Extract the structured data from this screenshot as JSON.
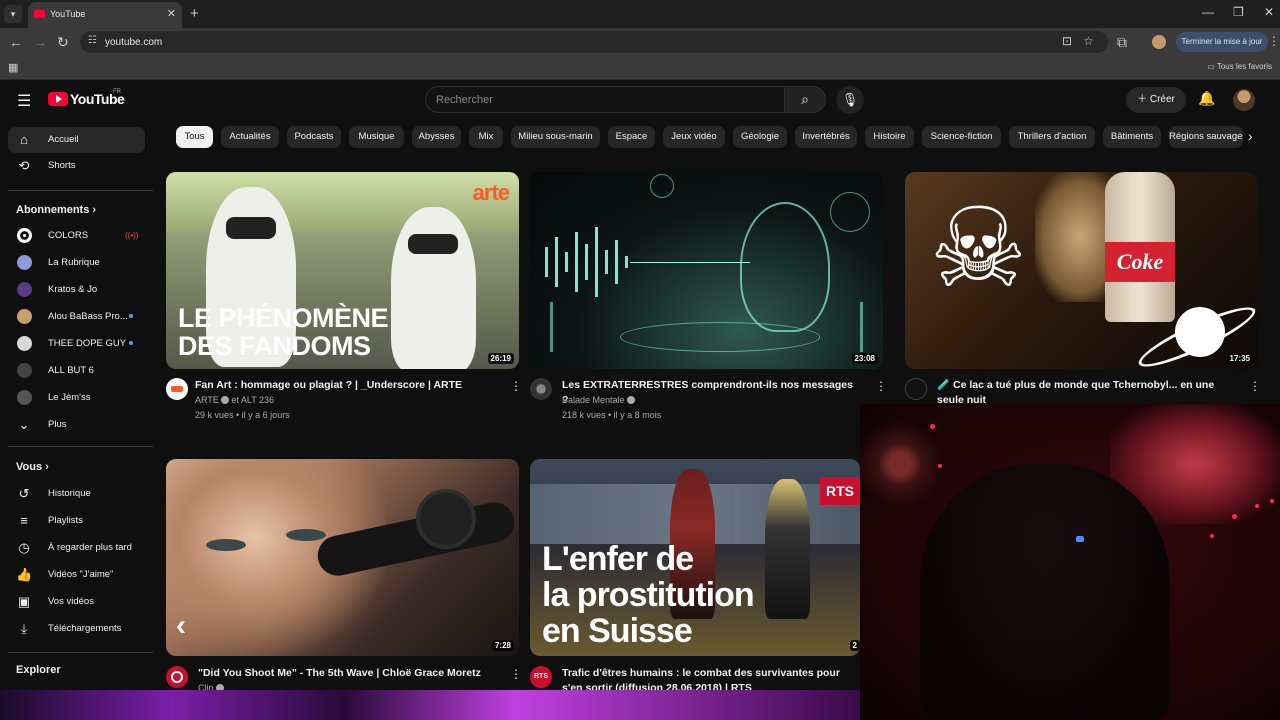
{
  "browser": {
    "tab_title": "YouTube",
    "url": "youtube.com",
    "update_label": "Terminer la mise à jour",
    "favorites_label": "Tous les favoris"
  },
  "header": {
    "logo_text": "YouTube",
    "region": "FR",
    "search_placeholder": "Rechercher",
    "create_label": "Créer"
  },
  "sidebar": {
    "main": [
      {
        "label": "Accueil",
        "icon": "home-icon"
      },
      {
        "label": "Shorts",
        "icon": "shorts-icon"
      }
    ],
    "subscriptions_title": "Abonnements",
    "subscriptions": [
      {
        "label": "COLORS",
        "color": "#ffffff"
      },
      {
        "label": "La Rubrique",
        "color": "#8a9bd6"
      },
      {
        "label": "Kratos & Jo",
        "color": "#5b3a8a"
      },
      {
        "label": "Alou BaBass Pro...",
        "color": "#c6a06a"
      },
      {
        "label": "THEE DOPE GUY",
        "color": "#d8d8d8"
      },
      {
        "label": "ALL BUT 6",
        "color": "#444444"
      },
      {
        "label": "Le Jèm'ss",
        "color": "#555555"
      }
    ],
    "more_label": "Plus",
    "you_title": "Vous",
    "you_items": [
      {
        "label": "Historique",
        "icon": "history-icon"
      },
      {
        "label": "Playlists",
        "icon": "playlists-icon"
      },
      {
        "label": "À regarder plus tard",
        "icon": "watch-later-icon"
      },
      {
        "label": "Vidéos \"J'aime\"",
        "icon": "like-icon"
      },
      {
        "label": "Vos vidéos",
        "icon": "your-videos-icon"
      },
      {
        "label": "Téléchargements",
        "icon": "download-icon"
      }
    ],
    "explore_title": "Explorer"
  },
  "chips": [
    "Tous",
    "Actualités",
    "Podcasts",
    "Musique",
    "Abysses",
    "Mix",
    "Milieu sous-marin",
    "Espace",
    "Jeux vidéo",
    "Géologie",
    "Invertébrés",
    "Histoire",
    "Science-fiction",
    "Thrillers d'action",
    "Bâtiments",
    "Régions sauvages"
  ],
  "videos": [
    {
      "title": "Fan Art : hommage ou plagiat ? | _Underscore | ARTE",
      "channel": "ARTE",
      "channel_extra": "et ALT 236",
      "meta": "29 k vues • il y a 6 jours",
      "duration": "26:19",
      "thumb_brand": "arte",
      "thumb_text_1": "LE PHÉNOMÈNE",
      "thumb_text_2": "DES FANDOMS"
    },
    {
      "title": "Les EXTRATERRESTRES comprendront-ils nos messages ?",
      "channel": "Balade Mentale",
      "meta": "218 k vues • il y a 8 mois",
      "duration": "23:08"
    },
    {
      "title": "🧪 Ce lac a tué plus de monde que Tchernobyl... en une seule nuit",
      "duration": "17:35",
      "thumb_brand": "Coke"
    },
    {
      "title": "\"Did You Shoot Me\" - The 5th Wave | Chloë Grace Moretz",
      "channel": "Clip",
      "duration": "7:28"
    },
    {
      "title": "Trafic d'êtres humains : le combat des survivantes pour s'en sortir (diffusion 28.06.2018) | RTS",
      "duration": "2",
      "thumb_brand": "RTS",
      "avatar_text": "RTS",
      "thumb_text_1": "L'enfer de",
      "thumb_text_2": "la prostitution",
      "thumb_text_3": "en Suisse"
    }
  ]
}
